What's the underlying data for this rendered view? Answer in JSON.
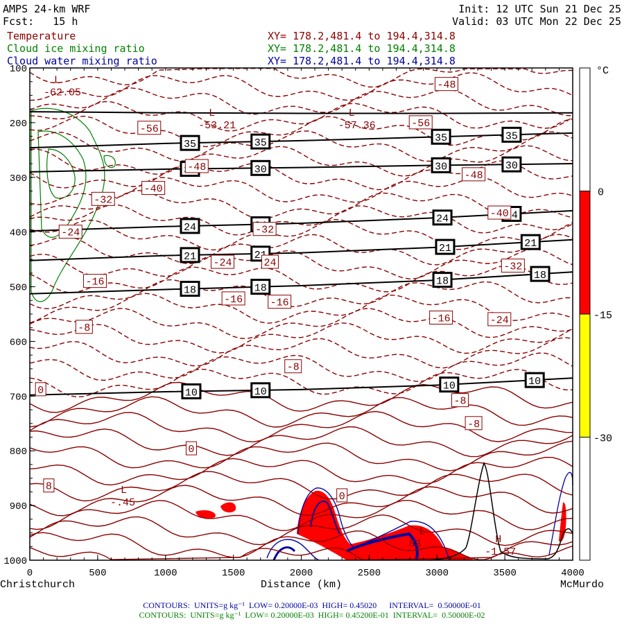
{
  "header": {
    "model": "AMPS 24-km WRF",
    "forecast": "Fcst:   15 h",
    "init": "Init: 12 UTC Sun 21 Dec 25",
    "valid": "Valid: 03 UTC Mon 22 Dec 25"
  },
  "fields": [
    {
      "name": "Temperature",
      "xy": "XY= 178.2,481.4 to 194.4,314.8",
      "color": "#8b0000"
    },
    {
      "name": "Cloud ice mixing ratio",
      "xy": "XY= 178.2,481.4 to 194.4,314.8",
      "color": "#008000"
    },
    {
      "name": "Cloud water mixing ratio",
      "xy": "XY= 178.2,481.4 to 194.4,314.8",
      "color": "#0000a0"
    }
  ],
  "footer": {
    "water": "CONTOURS:  UNITS=g kg⁻¹  LOW= 0.20000E-03  HIGH= 0.45020      INTERVAL=  0.50000E-01",
    "ice": "CONTOURS:  UNITS=g kg⁻¹  LOW= 0.20000E-03  HIGH= 0.45200E-01  INTERVAL=  0.50000E-02"
  },
  "chart_data": {
    "type": "line",
    "xlabel": "Distance (km)",
    "x_start_label": "Christchurch",
    "x_end_label": "McMurdo",
    "xlim": [
      0,
      4000
    ],
    "ylim": [
      100,
      1000
    ],
    "xticks": [
      0,
      500,
      1000,
      1500,
      2000,
      2500,
      3000,
      3500,
      4000
    ],
    "yticks": [
      100,
      200,
      300,
      400,
      500,
      600,
      700,
      800,
      900,
      1000
    ],
    "colorbar": {
      "unit": "°C",
      "labels": [
        "0",
        "-15",
        "-30"
      ],
      "bins": [
        {
          "from": 0,
          "to": -15,
          "color": "#ff0000"
        },
        {
          "from": -15,
          "to": -30,
          "color": "#ffff00"
        }
      ]
    },
    "black_contours": [
      {
        "label": "",
        "p": [
          180,
          182,
          183,
          183,
          182
        ],
        "label_km": []
      },
      {
        "label": "35",
        "p": [
          246,
          238,
          233,
          226,
          219
        ],
        "label_km": [
          1180,
          1700,
          3030,
          3550
        ]
      },
      {
        "label": "30",
        "p": [
          290,
          285,
          282,
          278,
          275
        ],
        "label_km": [
          1180,
          1700,
          3030,
          3550
        ]
      },
      {
        "label": "24",
        "p": [
          398,
          390,
          384,
          374,
          361
        ],
        "label_km": [
          1180,
          1700,
          3040,
          3550
        ]
      },
      {
        "label": "21",
        "p": [
          452,
          443,
          438,
          428,
          414
        ],
        "label_km": [
          1180,
          1700,
          3060,
          3690
        ]
      },
      {
        "label": "18",
        "p": [
          513,
          505,
          498,
          488,
          473
        ],
        "label_km": [
          1180,
          1700,
          3040,
          3760
        ]
      },
      {
        "label": "10",
        "p": [
          698,
          692,
          688,
          680,
          667
        ],
        "label_km": [
          1190,
          1700,
          3090,
          3720
        ]
      }
    ],
    "temperature_labels": [
      {
        "t": "-48",
        "km": 3070,
        "p": 130
      },
      {
        "t": "-56",
        "km": 880,
        "p": 210
      },
      {
        "t": "-56",
        "km": 2880,
        "p": 200
      },
      {
        "t": "-48",
        "km": 1230,
        "p": 280
      },
      {
        "t": "-40",
        "km": 910,
        "p": 320
      },
      {
        "t": "-32",
        "km": 540,
        "p": 340
      },
      {
        "t": "-48",
        "km": 3270,
        "p": 295
      },
      {
        "t": "-24",
        "km": 300,
        "p": 400
      },
      {
        "t": "-32",
        "km": 1730,
        "p": 395
      },
      {
        "t": "-40",
        "km": 3460,
        "p": 365
      },
      {
        "t": "-24",
        "km": 1420,
        "p": 455
      },
      {
        "t": "24",
        "km": 1770,
        "p": 455
      },
      {
        "t": "-32",
        "km": 3560,
        "p": 462
      },
      {
        "t": "-16",
        "km": 480,
        "p": 490
      },
      {
        "t": "-16",
        "km": 1500,
        "p": 522
      },
      {
        "t": "-16",
        "km": 1840,
        "p": 528
      },
      {
        "t": "-16",
        "km": 3030,
        "p": 557
      },
      {
        "t": "-24",
        "km": 3460,
        "p": 560
      },
      {
        "t": "-8",
        "km": 400,
        "p": 574
      },
      {
        "t": "-8",
        "km": 1940,
        "p": 646
      },
      {
        "t": "0",
        "km": 80,
        "p": 688
      },
      {
        "t": "-8",
        "km": 3170,
        "p": 708
      },
      {
        "t": "-8",
        "km": 3270,
        "p": 750
      },
      {
        "t": "0",
        "km": 1190,
        "p": 796
      },
      {
        "t": "8",
        "km": 140,
        "p": 864
      },
      {
        "t": "0",
        "km": 2300,
        "p": 882
      }
    ],
    "extrema": [
      {
        "kind": "L",
        "value": "-62.05",
        "km": 230,
        "p": 150
      },
      {
        "kind": "L",
        "value": "-53.21",
        "km": 1370,
        "p": 210
      },
      {
        "kind": "L",
        "value": "-57.36",
        "km": 2400,
        "p": 210
      },
      {
        "kind": "L",
        "value": "-.45",
        "km": 720,
        "p": 900
      },
      {
        "kind": "L",
        "value": "83",
        "km": 2920,
        "p": 975
      },
      {
        "kind": "H",
        "value": "-1.57",
        "km": 3480,
        "p": 990
      }
    ],
    "isotherm_interval": 4
  }
}
